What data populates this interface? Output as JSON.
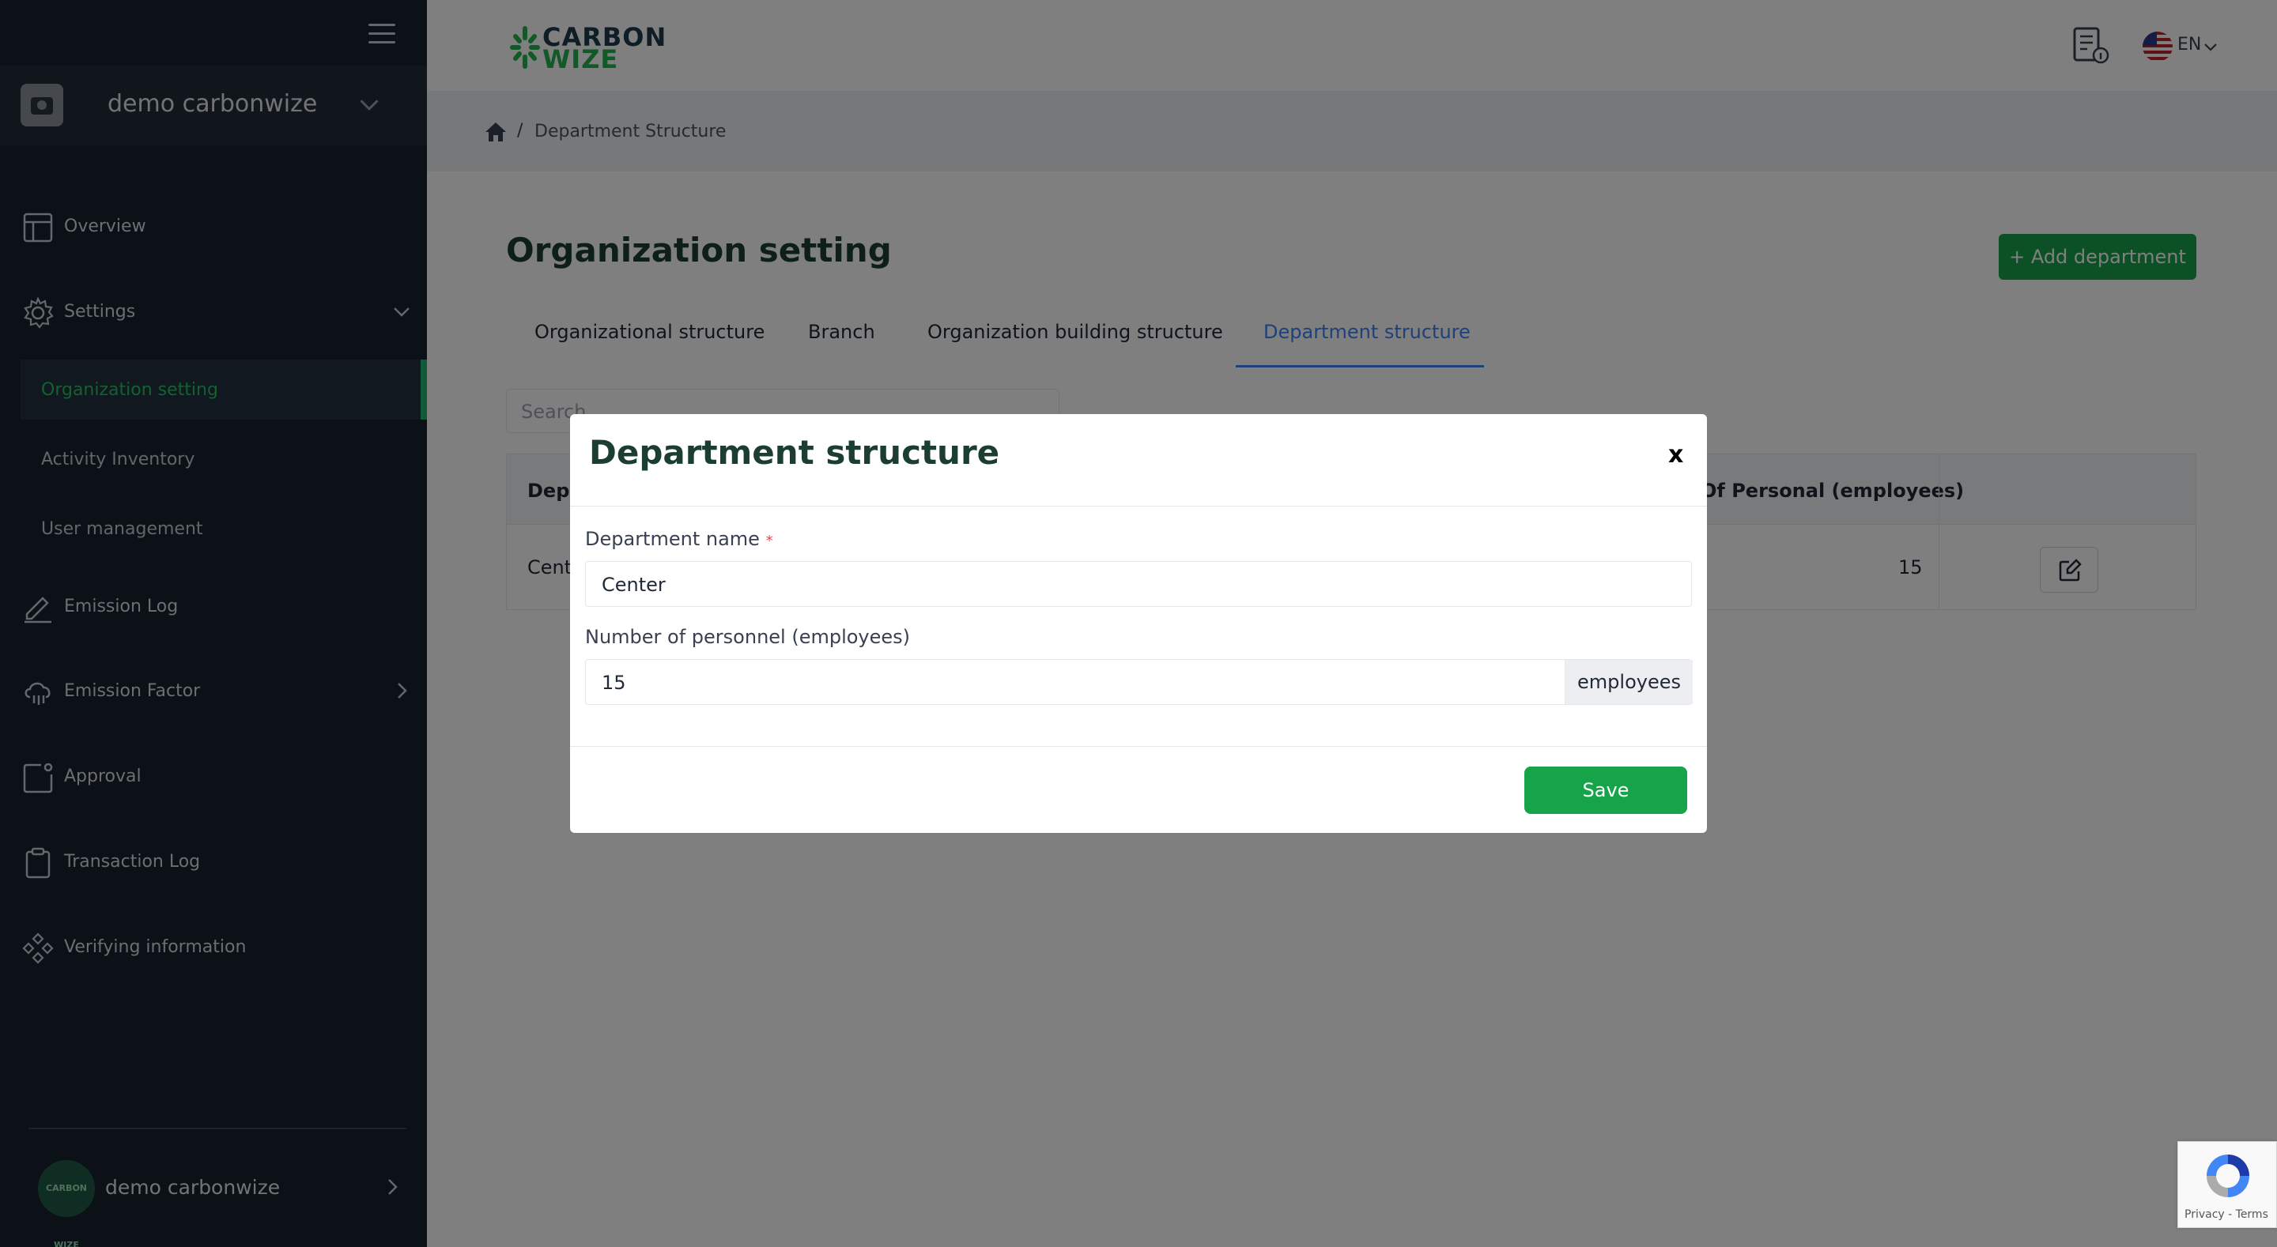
{
  "sidebar": {
    "account_name": "demo carbonwize",
    "items": [
      {
        "label": "Overview"
      },
      {
        "label": "Settings"
      },
      {
        "label": "Emission Log"
      },
      {
        "label": "Emission Factor"
      },
      {
        "label": "Approval"
      },
      {
        "label": "Transaction Log"
      },
      {
        "label": "Verifying information"
      }
    ],
    "settings_sub": [
      {
        "label": "Organization setting",
        "active": true
      },
      {
        "label": "Activity Inventory"
      },
      {
        "label": "User management"
      }
    ],
    "user_name": "demo carbonwize",
    "avatar_text": "CARBON WIZE"
  },
  "header": {
    "logo_line1": "CARBON",
    "logo_line2": "WIZE",
    "language": "EN"
  },
  "breadcrumb": {
    "separator": "/",
    "current": "Department Structure"
  },
  "page": {
    "title": "Organization setting",
    "add_button": "+ Add department",
    "tabs": [
      {
        "label": "Organizational structure"
      },
      {
        "label": "Branch"
      },
      {
        "label": "Organization building structure"
      },
      {
        "label": "Department structure",
        "active": true
      }
    ],
    "search_placeholder": "Search",
    "table": {
      "headers": [
        "Depa",
        "Of Personal (employees)"
      ],
      "rows": [
        {
          "name": "Cent",
          "count": "15"
        }
      ]
    }
  },
  "modal": {
    "title": "Department structure",
    "close_label": "x",
    "department_label": "Department name",
    "required_mark": "*",
    "department_value": "Center",
    "personnel_label": "Number of personnel (employees)",
    "personnel_value": "15",
    "personnel_unit": "employees",
    "save_label": "Save"
  },
  "recaptcha": {
    "text": "Privacy - Terms"
  },
  "colors": {
    "sidebar_bg": "#18222f",
    "accent_green": "#16a34a",
    "tab_active": "#3b82f6",
    "title_color": "#1c3d33"
  }
}
